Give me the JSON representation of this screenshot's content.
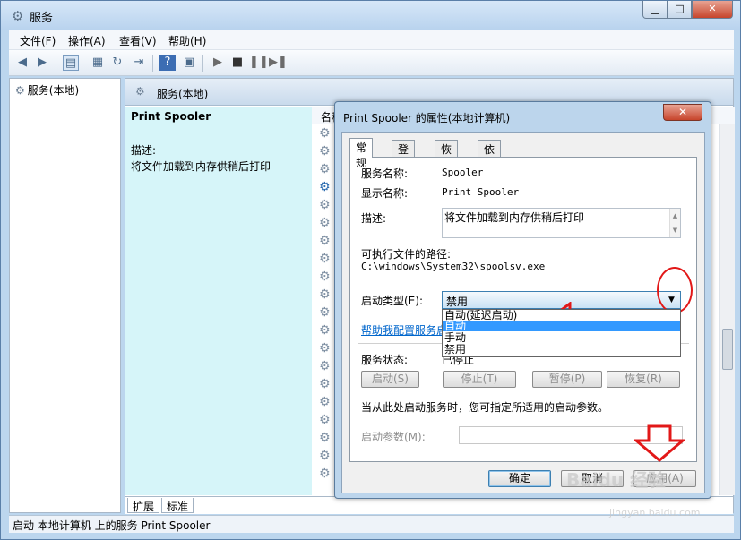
{
  "window": {
    "title": "服务"
  },
  "menu": [
    "文件(F)",
    "操作(A)",
    "查看(V)",
    "帮助(H)"
  ],
  "tree": {
    "root_label": "服务(本地)"
  },
  "right_header": "服务(本地)",
  "desc_panel": {
    "service_name": "Print Spooler",
    "desc_label": "描述:",
    "desc_text": "将文件加载到内存供稍后打印"
  },
  "list": {
    "column_name": "名称"
  },
  "bottom_tabs": [
    "扩展",
    "标准"
  ],
  "status_text": "启动 本地计算机 上的服务 Print Spooler",
  "dialog": {
    "title": "Print Spooler 的属性(本地计算机)",
    "tabs": [
      "常规",
      "登录",
      "恢复",
      "依存关系"
    ],
    "service_name_label": "服务名称:",
    "service_name_value": "Spooler",
    "display_name_label": "显示名称:",
    "display_name_value": "Print Spooler",
    "description_label": "描述:",
    "description_value": "将文件加载到内存供稍后打印",
    "path_label": "可执行文件的路径:",
    "path_value": "C:\\windows\\System32\\spoolsv.exe",
    "startup_type_label": "启动类型(E):",
    "startup_type_value": "禁用",
    "startup_options": [
      "自动(延迟启动)",
      "自动",
      "手动",
      "禁用"
    ],
    "help_link": "帮助我配置服务启动",
    "status_label": "服务状态:",
    "status_value": "已停止",
    "btn_start": "启动(S)",
    "btn_stop": "停止(T)",
    "btn_pause": "暂停(P)",
    "btn_resume": "恢复(R)",
    "hint": "当从此处启动服务时，您可指定所适用的启动参数。",
    "param_label": "启动参数(M):",
    "btn_ok": "确定",
    "btn_cancel": "取消",
    "btn_apply": "应用(A)"
  },
  "watermark": {
    "brand": "Baidu 经验",
    "url": "jingyan.baidu.com"
  }
}
